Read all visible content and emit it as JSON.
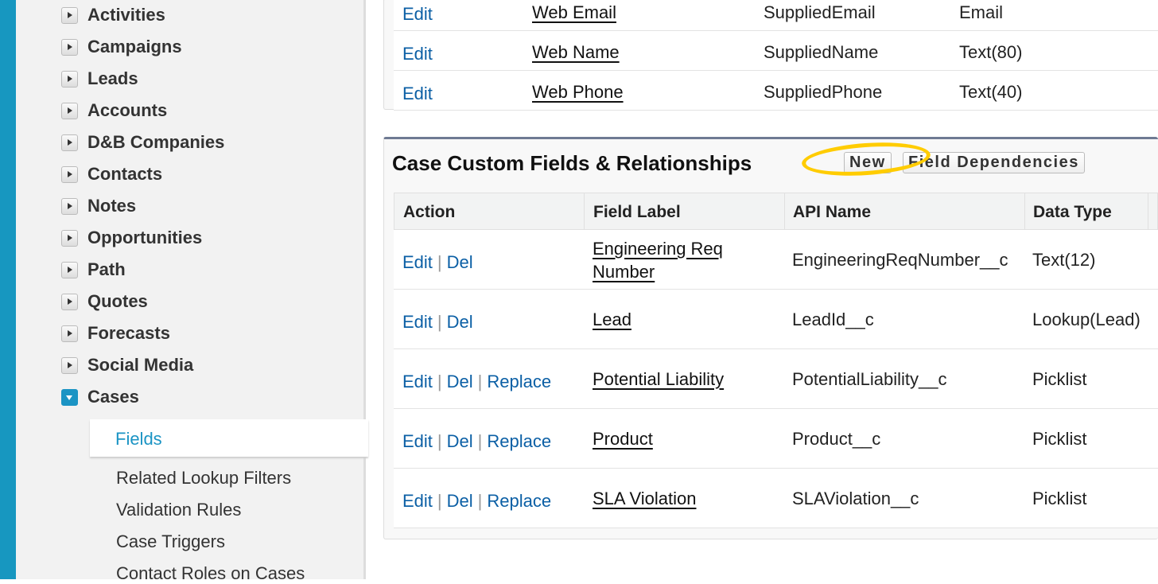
{
  "sidebar": {
    "items": [
      {
        "label": "Activities",
        "expanded": false
      },
      {
        "label": "Campaigns",
        "expanded": false
      },
      {
        "label": "Leads",
        "expanded": false
      },
      {
        "label": "Accounts",
        "expanded": false
      },
      {
        "label": "D&B Companies",
        "expanded": false
      },
      {
        "label": "Contacts",
        "expanded": false
      },
      {
        "label": "Notes",
        "expanded": false
      },
      {
        "label": "Opportunities",
        "expanded": false
      },
      {
        "label": "Path",
        "expanded": false
      },
      {
        "label": "Quotes",
        "expanded": false
      },
      {
        "label": "Forecasts",
        "expanded": false
      },
      {
        "label": "Social Media",
        "expanded": false
      },
      {
        "label": "Cases",
        "expanded": true
      }
    ],
    "subitems": [
      {
        "label": "Fields",
        "selected": true
      },
      {
        "label": "Related Lookup Filters"
      },
      {
        "label": "Validation Rules"
      },
      {
        "label": "Case Triggers"
      },
      {
        "label": "Contact Roles on Cases"
      }
    ]
  },
  "standard_fields": {
    "rows": [
      {
        "action": "Edit",
        "label": "Web Email",
        "api": "SuppliedEmail",
        "type": "Email"
      },
      {
        "action": "Edit",
        "label": "Web Name",
        "api": "SuppliedName",
        "type": "Text(80)"
      },
      {
        "action": "Edit",
        "label": "Web Phone",
        "api": "SuppliedPhone",
        "type": "Text(40)"
      }
    ]
  },
  "custom_fields": {
    "title": "Case Custom Fields & Relationships",
    "new_label": "New",
    "deps_label": "Field Dependencies",
    "columns": [
      "Action",
      "Field Label",
      "API Name",
      "Data Type"
    ],
    "rows": [
      {
        "actions": [
          "Edit",
          "Del"
        ],
        "label": "Engineering Req Number",
        "api": "EngineeringReqNumber__c",
        "type": "Text(12)"
      },
      {
        "actions": [
          "Edit",
          "Del"
        ],
        "label": "Lead",
        "api": "LeadId__c",
        "type": "Lookup(Lead)"
      },
      {
        "actions": [
          "Edit",
          "Del",
          "Replace"
        ],
        "label": "Potential Liability",
        "api": "PotentialLiability__c",
        "type": "Picklist"
      },
      {
        "actions": [
          "Edit",
          "Del",
          "Replace"
        ],
        "label": "Product",
        "api": "Product__c",
        "type": "Picklist"
      },
      {
        "actions": [
          "Edit",
          "Del",
          "Replace"
        ],
        "label": "SLA Violation",
        "api": "SLAViolation__c",
        "type": "Picklist"
      }
    ]
  },
  "colors": {
    "accent": "#1b94c4",
    "link": "#0b5fa5",
    "highlight": "#ffcc00"
  }
}
